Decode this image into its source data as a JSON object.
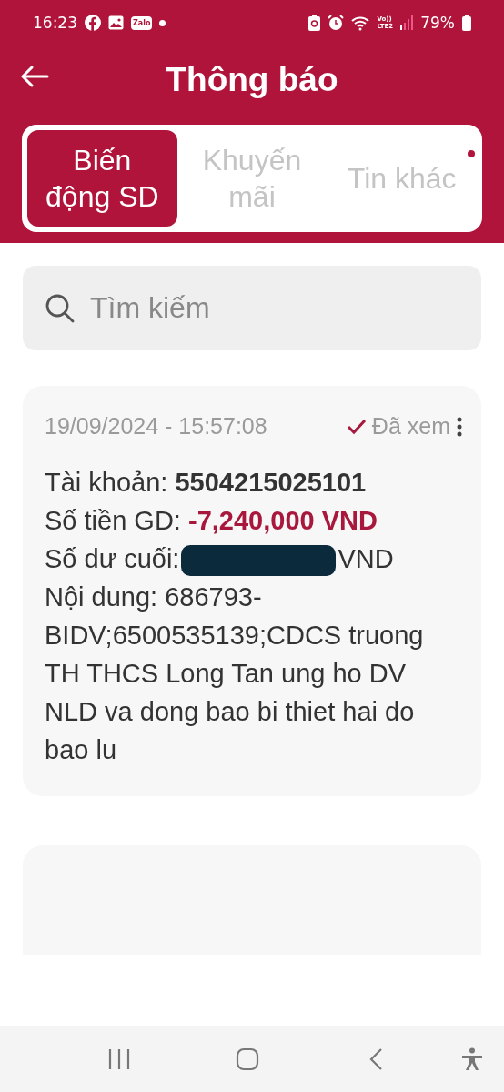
{
  "status_bar": {
    "time": "16:23",
    "app_icon_text": "Zalo",
    "network_top": "Vo))",
    "network_bottom": "LTE2",
    "battery": "79%"
  },
  "header": {
    "title": "Thông báo"
  },
  "tabs": [
    {
      "label": "Biến động SD",
      "selected": true,
      "has_new": false
    },
    {
      "label": "Khuyến mãi",
      "selected": false,
      "has_new": false
    },
    {
      "label": "Tin khác",
      "selected": false,
      "has_new": true
    }
  ],
  "search": {
    "placeholder": "Tìm kiếm"
  },
  "notifications": [
    {
      "timestamp": "19/09/2024 - 15:57:08",
      "read": true,
      "read_label": "Đã xem",
      "account_label": "Tài khoản:",
      "account": "5504215025101",
      "amount_label": "Số tiền GD:",
      "amount": "-7,240,000 VND",
      "balance_label": "Số dư cuối:",
      "balance_currency": "VND",
      "content": "Nội dung: 686793-BIDV;6500535139;CDCS truong TH THCS Long Tan ung ho DV NLD va dong bao bi thiet hai do bao lu"
    }
  ]
}
